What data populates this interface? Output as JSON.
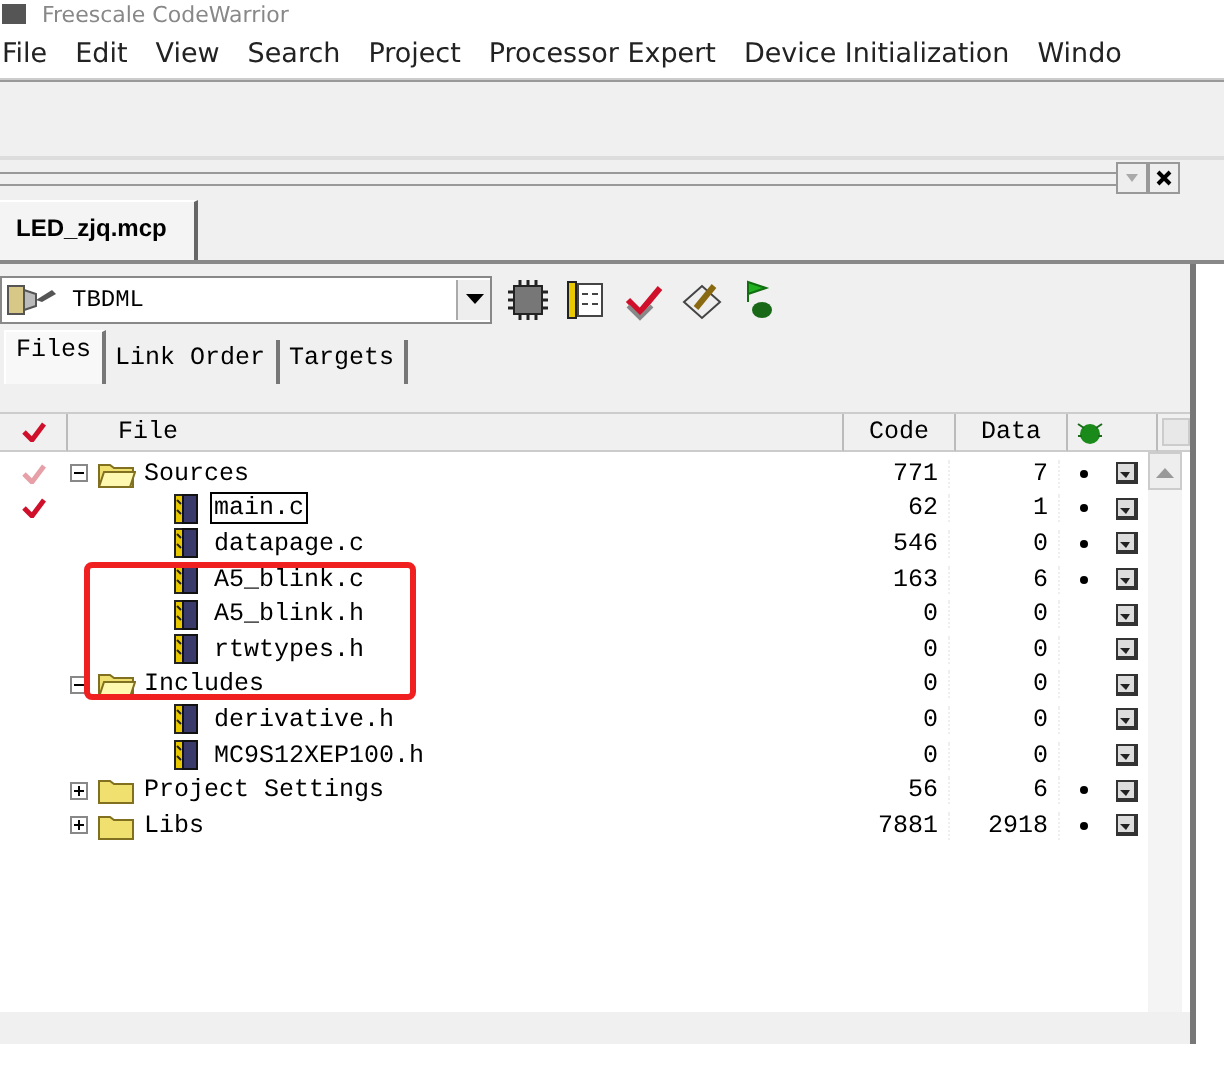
{
  "window": {
    "title": "Freescale CodeWarrior"
  },
  "menu": [
    "File",
    "Edit",
    "View",
    "Search",
    "Project",
    "Processor Expert",
    "Device Initialization",
    "Windo"
  ],
  "project_tab": {
    "label": "LED_zjq.mcp"
  },
  "target": {
    "value": "TBDML"
  },
  "tabs": [
    {
      "label": "Files",
      "selected": true
    },
    {
      "label": "Link Order",
      "selected": false
    },
    {
      "label": "Targets",
      "selected": false
    }
  ],
  "table": {
    "columns": [
      "File",
      "Code",
      "Data"
    ],
    "rows": [
      {
        "kind": "folder",
        "name": "Sources",
        "expanded": true,
        "color": "#e8a0a8",
        "selected": false,
        "code": "771",
        "data": "7",
        "dot": true,
        "children": [
          {
            "kind": "file",
            "name": "main.c",
            "color": "#d0102a",
            "selected": true,
            "code": "62",
            "data": "1",
            "dot": true
          },
          {
            "kind": "file",
            "name": "datapage.c",
            "selected": false,
            "code": "546",
            "data": "0",
            "dot": true
          },
          {
            "kind": "file",
            "name": "A5_blink.c",
            "selected": false,
            "code": "163",
            "data": "6",
            "dot": true
          },
          {
            "kind": "file",
            "name": "A5_blink.h",
            "selected": false,
            "code": "0",
            "data": "0",
            "dot": false
          },
          {
            "kind": "file",
            "name": "rtwtypes.h",
            "selected": false,
            "code": "0",
            "data": "0",
            "dot": false
          }
        ]
      },
      {
        "kind": "folder",
        "name": "Includes",
        "expanded": true,
        "selected": false,
        "code": "0",
        "data": "0",
        "dot": false,
        "children": [
          {
            "kind": "file",
            "name": "derivative.h",
            "selected": false,
            "code": "0",
            "data": "0",
            "dot": false
          },
          {
            "kind": "file",
            "name": "MC9S12XEP100.h",
            "selected": false,
            "code": "0",
            "data": "0",
            "dot": false
          }
        ]
      },
      {
        "kind": "folder",
        "name": "Project Settings",
        "expanded": false,
        "selected": false,
        "code": "56",
        "data": "6",
        "dot": true
      },
      {
        "kind": "folder",
        "name": "Libs",
        "expanded": false,
        "selected": false,
        "code": "7881",
        "data": "2918",
        "dot": true
      }
    ]
  }
}
